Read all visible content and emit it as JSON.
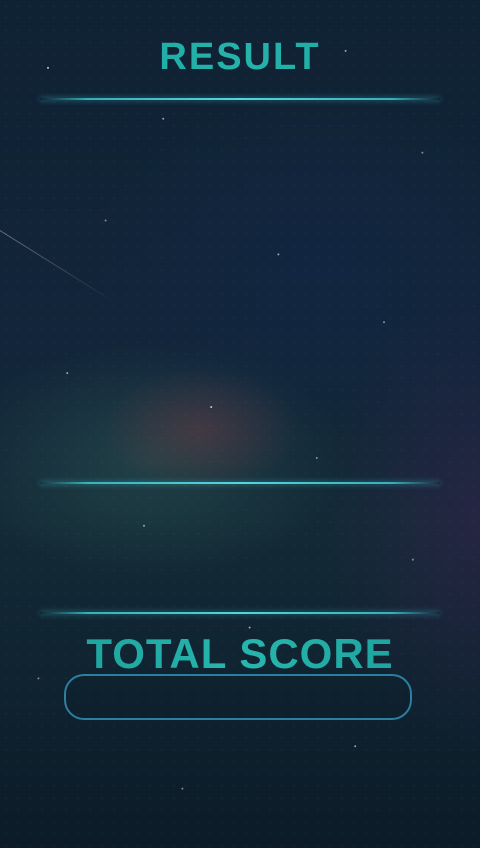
{
  "screen": {
    "title": "RESULT"
  },
  "total_score": {
    "label": "TOTAL SCORE",
    "value": ""
  },
  "colors": {
    "accent_teal": "#24b3ab",
    "line_cyan": "#53d6e0",
    "box_border": "#2c7fa0",
    "background": "#0f2233"
  }
}
